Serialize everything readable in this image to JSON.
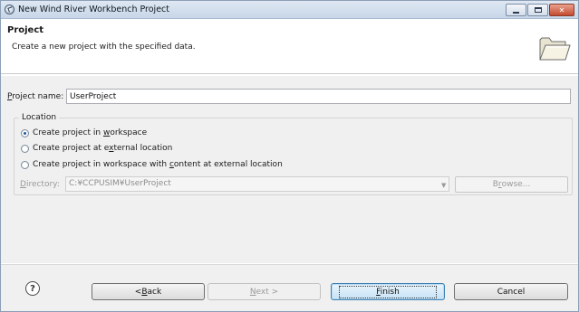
{
  "window": {
    "title": "New Wind River Workbench Project",
    "minimize_label": "",
    "maximize_label": "",
    "close_label": "✕"
  },
  "header": {
    "title": "Project",
    "description": "Create a new project with the specified data."
  },
  "project_name": {
    "label_prefix": "",
    "label_mnemonic": "P",
    "label_rest": "roject name:",
    "value": "UserProject"
  },
  "location": {
    "legend": "Location",
    "options": [
      {
        "pre": "Create project in ",
        "mn": "w",
        "post": "orkspace",
        "checked": true
      },
      {
        "pre": "Create project at e",
        "mn": "x",
        "post": "ternal location",
        "checked": false
      },
      {
        "pre": "Create project in workspace with ",
        "mn": "c",
        "post": "ontent at external location",
        "checked": false
      }
    ],
    "directory_label_mn": "D",
    "directory_label_rest": "irectory:",
    "directory_value": "C:¥CCPUSIM¥UserProject",
    "browse_pre": "B",
    "browse_mn": "r",
    "browse_post": "owse..."
  },
  "footer": {
    "help_label": "?",
    "back_pre": "< ",
    "back_mn": "B",
    "back_post": "ack",
    "next_pre": "",
    "next_mn": "N",
    "next_post": "ext >",
    "finish_mn": "F",
    "finish_post": "inish",
    "cancel_label": "Cancel"
  },
  "colors": {
    "titlebar": "#c7d6e8",
    "dialog_bg": "#f0f0f0",
    "default_button": "#c6e2f6"
  }
}
